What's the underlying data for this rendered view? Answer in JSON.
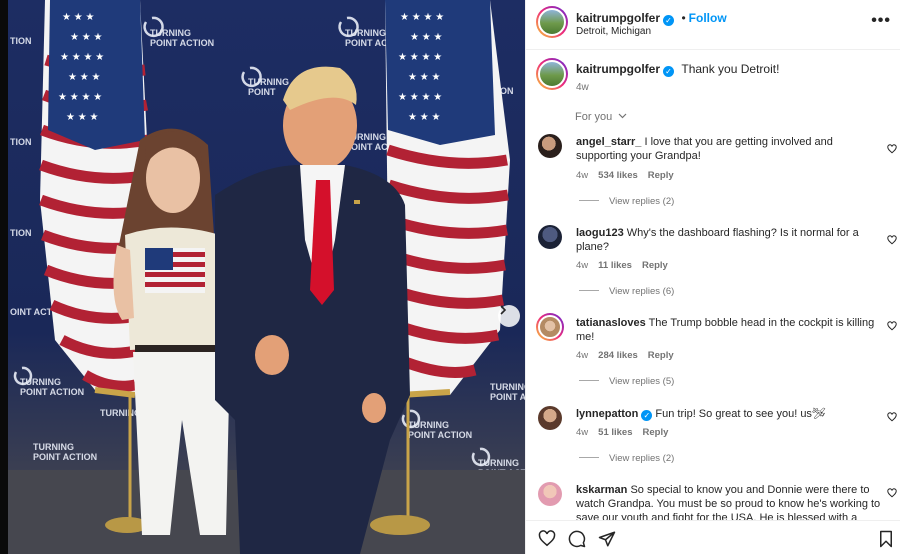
{
  "photo": {
    "brand_text": "TURNING POINT ACTION",
    "accent_navy": "#1d2d63",
    "flag_red": "#b22234",
    "tie_red": "#d4102b"
  },
  "header": {
    "username": "kaitrumpgolfer",
    "verified_badge": "✓",
    "follow_label": "Follow",
    "location": "Detroit, Michigan",
    "more_label": "•••"
  },
  "caption": {
    "username": "kaitrumpgolfer",
    "text": "Thank you Detroit!",
    "time": "4w"
  },
  "sort_label": "For you",
  "comments": [
    {
      "username": "angel_starr_",
      "text": "I love that you are getting involved and supporting your Grandpa!",
      "time": "4w",
      "likes": "534 likes",
      "reply": "Reply",
      "view_replies": "View replies (2)"
    },
    {
      "username": "laogu123",
      "text": "Why's the dashboard flashing? Is it normal for a plane?",
      "time": "4w",
      "likes": "11 likes",
      "reply": "Reply",
      "view_replies": "View replies (6)"
    },
    {
      "username": "tatianasloves",
      "text": "The Trump bobble head in the cockpit is killing me!",
      "time": "4w",
      "likes": "284 likes",
      "reply": "Reply",
      "view_replies": "View replies (5)"
    },
    {
      "username": "lynnepatton",
      "text": "Fun trip! So great to see you! us🛩",
      "time": "4w",
      "likes": "51 likes",
      "reply": "Reply",
      "view_replies": "View replies (2)"
    },
    {
      "username": "kskarman",
      "text": "So special to know you and Donnie were there to watch Grandpa. You must be so proud to know he's working to save our youth and fight for the USA. He is blessed with a",
      "time": "",
      "likes": "",
      "reply": "",
      "view_replies": ""
    }
  ],
  "icons": {
    "like": "heart-icon",
    "comment": "comment-icon",
    "share": "share-icon",
    "save": "bookmark-icon"
  }
}
